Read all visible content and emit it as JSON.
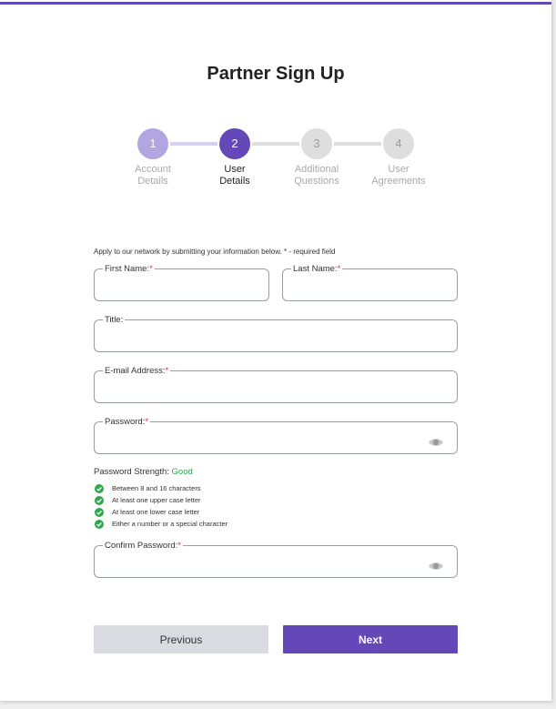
{
  "page": {
    "title": "Partner Sign Up",
    "accent_color": "#6448b8"
  },
  "stepper": {
    "steps": [
      {
        "number": "1",
        "label_line1": "Account",
        "label_line2": "Details",
        "state": "completed"
      },
      {
        "number": "2",
        "label_line1": "User",
        "label_line2": "Details",
        "state": "active"
      },
      {
        "number": "3",
        "label_line1": "Additional",
        "label_line2": "Questions",
        "state": "upcoming"
      },
      {
        "number": "4",
        "label_line1": "User",
        "label_line2": "Agreements",
        "state": "upcoming"
      }
    ]
  },
  "form": {
    "intro": "Apply to our network by submitting your information below. * - required field",
    "required_mark": "*",
    "fields": {
      "first_name": {
        "label": "First Name:",
        "value": "",
        "required": true
      },
      "last_name": {
        "label": "Last Name:",
        "value": "",
        "required": true
      },
      "title": {
        "label": "Title:",
        "value": "",
        "required": false
      },
      "email": {
        "label": "E-mail Address:",
        "value": "",
        "required": true
      },
      "password": {
        "label": "Password:",
        "value": "",
        "required": true,
        "icon": "eye-icon"
      },
      "confirm_password": {
        "label": "Confirm Password:",
        "value": "",
        "required": true,
        "icon": "eye-icon"
      }
    },
    "password_strength": {
      "label": "Password Strength:",
      "value": "Good",
      "color": "#2ea84a"
    },
    "rules": [
      {
        "text": "Between 8 and 16 characters",
        "met": true,
        "icon": "check-circle-icon"
      },
      {
        "text": "At least one upper case letter",
        "met": true,
        "icon": "check-circle-icon"
      },
      {
        "text": "At least one lower case letter",
        "met": true,
        "icon": "check-circle-icon"
      },
      {
        "text": "Either a number or a special character",
        "met": true,
        "icon": "check-circle-icon"
      }
    ]
  },
  "buttons": {
    "previous": "Previous",
    "next": "Next"
  }
}
